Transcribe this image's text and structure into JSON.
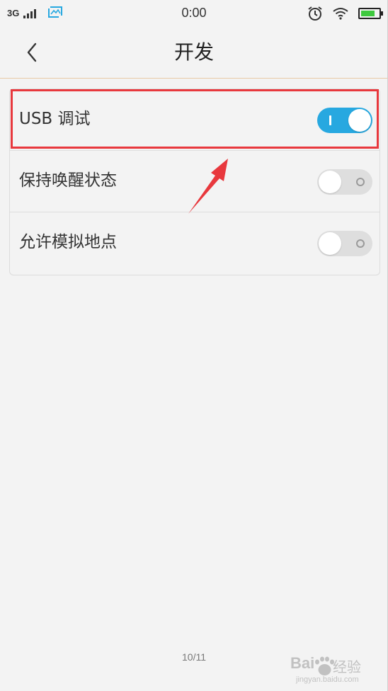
{
  "status_bar": {
    "network": "3G",
    "time": "0:00",
    "icons": [
      "signal-bars-icon",
      "photo-icon",
      "alarm-icon",
      "wifi-icon",
      "battery-icon"
    ],
    "battery_level_fraction": 0.75,
    "battery_color": "#3ec93e"
  },
  "header": {
    "title": "开发",
    "back_icon": "chevron-left-icon"
  },
  "settings": [
    {
      "label": "USB 调试",
      "toggle_on": true
    },
    {
      "label": "保持唤醒状态",
      "toggle_on": false
    },
    {
      "label": "允许模拟地点",
      "toggle_on": false
    }
  ],
  "annotation": {
    "highlight_color": "#e8383d",
    "arrow_icon": "red-arrow-icon"
  },
  "colors": {
    "toggle_on": "#27a8e0",
    "toggle_off": "#dedede",
    "header_divider": "#e8c9a6"
  },
  "page_indicator": "10/11",
  "watermark": {
    "brand": "Bai",
    "cn": "经验",
    "url": "jingyan.baidu.com"
  }
}
